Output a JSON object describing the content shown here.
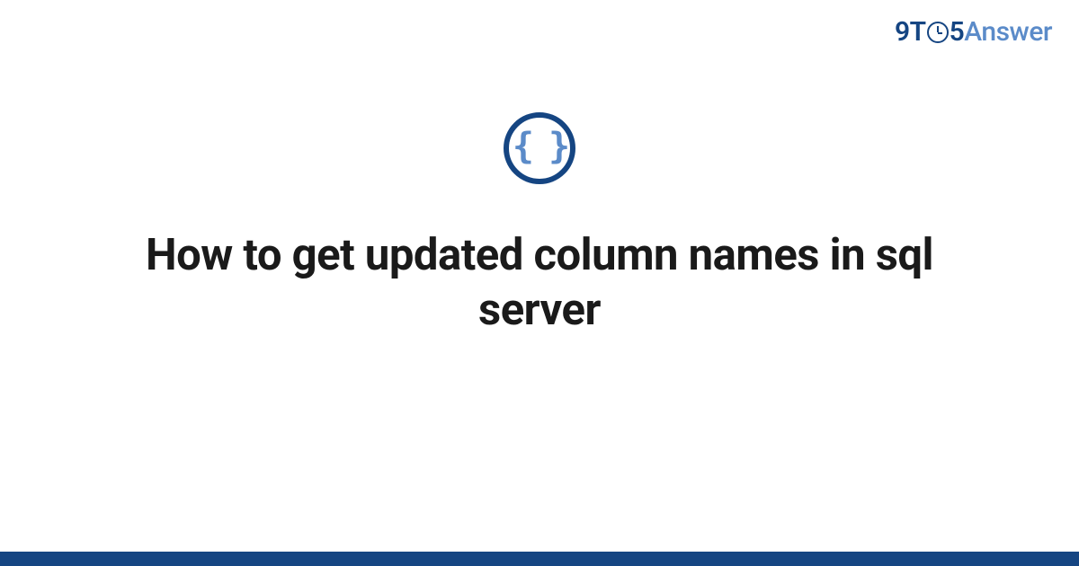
{
  "logo": {
    "part1": "9T",
    "part2": "5",
    "part3": "Answer"
  },
  "icon": {
    "braces": "{ }"
  },
  "title": "How to get updated column names in sql server",
  "colors": {
    "primary": "#154582",
    "accent": "#5b8bc9"
  }
}
